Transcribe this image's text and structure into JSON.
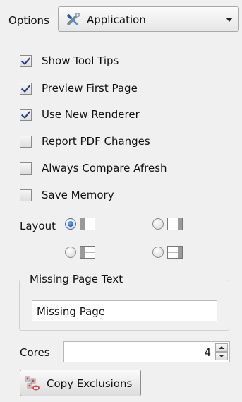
{
  "options": {
    "label_accel": "O",
    "label_rest": "ptions",
    "selected": "Application",
    "icon": "wrench-screwdriver-icon"
  },
  "checkboxes": [
    {
      "label": "Show Tool Tips",
      "checked": true
    },
    {
      "label": "Preview First Page",
      "checked": true
    },
    {
      "label": "Use New Renderer",
      "checked": true
    },
    {
      "label": "Report PDF Changes",
      "checked": false
    },
    {
      "label": "Always Compare Afresh",
      "checked": false
    },
    {
      "label": "Save Memory",
      "checked": false
    }
  ],
  "layout": {
    "label": "Layout",
    "options": [
      {
        "icon": "layout-left-panel-icon",
        "selected": true
      },
      {
        "icon": "layout-right-panel-icon",
        "selected": false
      },
      {
        "icon": "layout-top-panel-icon",
        "selected": false
      },
      {
        "icon": "layout-bottom-panel-icon",
        "selected": false
      }
    ]
  },
  "missing_page": {
    "title": "Missing Page Text",
    "value": "Missing Page"
  },
  "cores": {
    "label": "Cores",
    "value": "4"
  },
  "copy_exclusions": {
    "label": "Copy Exclusions",
    "icon": "copy-exclusions-icon"
  }
}
